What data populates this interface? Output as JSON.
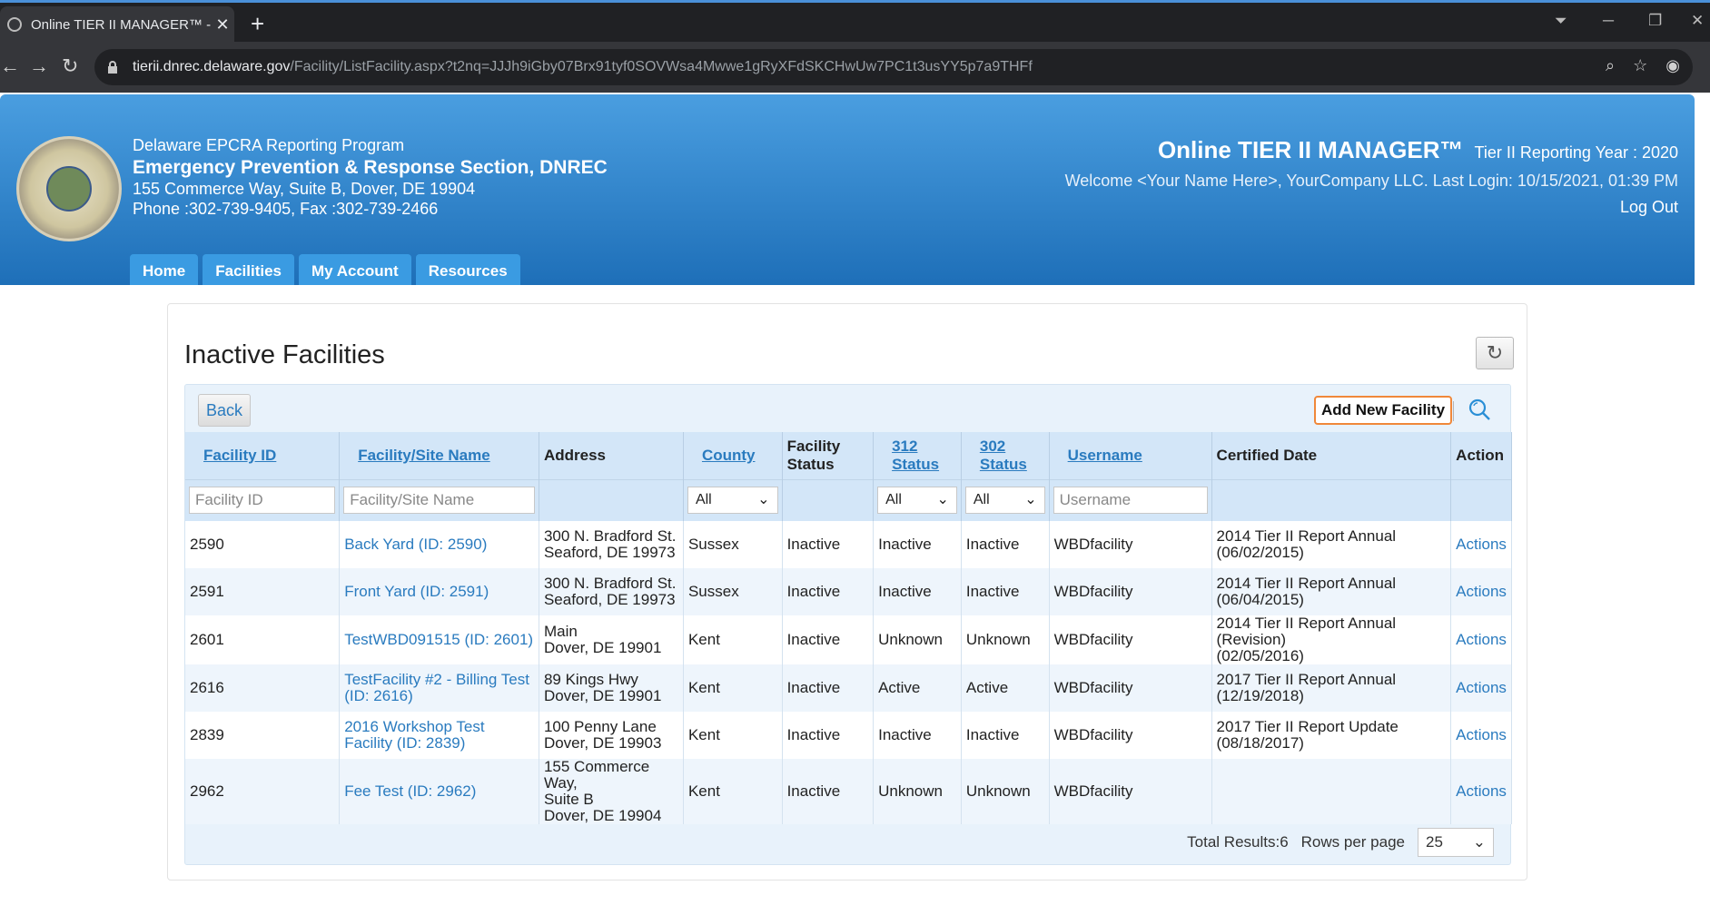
{
  "browser": {
    "tab_title": "Online TIER II MANAGER™ - Facil",
    "tab_close": "✕",
    "new_tab": "+",
    "url_host": "tierii.dnrec.delaware.gov",
    "url_path": "/Facility/ListFacility.aspx?t2nq=JJJh9iGby07Brx91tyf0SOVWsa4Mwwe1gRyXFdSKCHwUw7PC1t3usYY5p7a9THFf"
  },
  "header": {
    "org_line1": "Delaware EPCRA Reporting Program",
    "org_line2": "Emergency Prevention & Response Section, DNREC",
    "org_line3": "155 Commerce Way, Suite B, Dover, DE 19904",
    "org_line4": "Phone :302-739-9405, Fax :302-739-2466",
    "app_name": "Online TIER II MANAGER™",
    "reporting_year": "Tier II Reporting Year : 2020",
    "welcome": "Welcome <Your Name Here>, YourCompany LLC.   Last Login: 10/15/2021, 01:39 PM",
    "logout": "Log Out"
  },
  "nav": {
    "home": "Home",
    "facilities": "Facilities",
    "my_account": "My Account",
    "resources": "Resources"
  },
  "page": {
    "title": "Inactive Facilities",
    "back": "Back",
    "add_new": "Add New Facility"
  },
  "table": {
    "headers": {
      "facility_id": "Facility ID",
      "site_name": "Facility/Site Name",
      "address": "Address",
      "county": "County",
      "facility_status_1": "Facility",
      "facility_status_2": "Status",
      "s312_1": "312",
      "s312_2": "Status",
      "s302_1": "302",
      "s302_2": "Status",
      "username": "Username",
      "certified_date": "Certified Date",
      "action": "Action"
    },
    "filters": {
      "facility_id_placeholder": "Facility ID",
      "site_name_placeholder": "Facility/Site Name",
      "county": "All",
      "s312": "All",
      "s302": "All",
      "username_placeholder": "Username"
    },
    "rows": [
      {
        "id": "2590",
        "name": "Back Yard (ID: 2590)",
        "addr1": "300 N. Bradford St.",
        "addr2": "Seaford, DE 19973",
        "addr3": "",
        "county": "Sussex",
        "fstatus": "Inactive",
        "s312": "Inactive",
        "s302": "Inactive",
        "user": "WBDfacility",
        "cert1": "2014 Tier II Report Annual",
        "cert2": "(06/02/2015)",
        "action": "Actions"
      },
      {
        "id": "2591",
        "name": "Front Yard (ID: 2591)",
        "addr1": "300 N. Bradford St.",
        "addr2": "Seaford, DE 19973",
        "addr3": "",
        "county": "Sussex",
        "fstatus": "Inactive",
        "s312": "Inactive",
        "s302": "Inactive",
        "user": "WBDfacility",
        "cert1": "2014 Tier II Report Annual",
        "cert2": "(06/04/2015)",
        "action": "Actions"
      },
      {
        "id": "2601",
        "name": "TestWBD091515 (ID: 2601)",
        "addr1": "Main",
        "addr2": "Dover, DE 19901",
        "addr3": "",
        "county": "Kent",
        "fstatus": "Inactive",
        "s312": "Unknown",
        "s302": "Unknown",
        "user": "WBDfacility",
        "cert1": "2014 Tier II Report Annual (Revision)",
        "cert2": "(02/05/2016)",
        "action": "Actions"
      },
      {
        "id": "2616",
        "name": "TestFacility #2 - Billing Test (ID: 2616)",
        "addr1": "89 Kings Hwy",
        "addr2": "Dover, DE 19901",
        "addr3": "",
        "county": "Kent",
        "fstatus": "Inactive",
        "s312": "Active",
        "s302": "Active",
        "user": "WBDfacility",
        "cert1": "2017 Tier II Report Annual",
        "cert2": "(12/19/2018)",
        "action": "Actions"
      },
      {
        "id": "2839",
        "name": "2016 Workshop Test Facility (ID: 2839)",
        "addr1": "100 Penny Lane",
        "addr2": "Dover, DE 19903",
        "addr3": "",
        "county": "Kent",
        "fstatus": "Inactive",
        "s312": "Inactive",
        "s302": "Inactive",
        "user": "WBDfacility",
        "cert1": "2017 Tier II Report Update",
        "cert2": "(08/18/2017)",
        "action": "Actions"
      },
      {
        "id": "2962",
        "name": "Fee Test (ID: 2962)",
        "addr1": "155 Commerce Way,",
        "addr2": "Suite B",
        "addr3": "Dover, DE 19904",
        "county": "Kent",
        "fstatus": "Inactive",
        "s312": "Unknown",
        "s302": "Unknown",
        "user": "WBDfacility",
        "cert1": "",
        "cert2": "",
        "action": "Actions"
      }
    ],
    "total_results": "Total Results:6",
    "rows_per_page_label": "Rows per page",
    "rows_per_page": "25"
  }
}
